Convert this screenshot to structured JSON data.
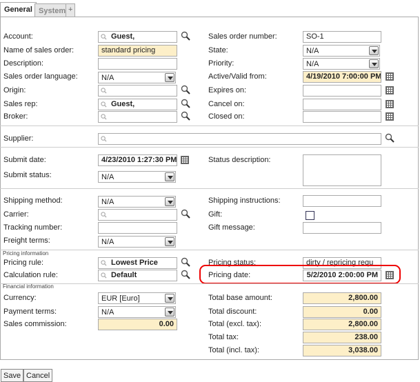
{
  "tabs": [
    "General",
    "System",
    "+"
  ],
  "left": {
    "account": {
      "label": "Account:",
      "value": "Guest,"
    },
    "order_name": {
      "label": "Name of sales order:",
      "value": "standard pricing"
    },
    "description": {
      "label": "Description:",
      "value": ""
    },
    "language": {
      "label": "Sales order language:",
      "value": "N/A"
    },
    "origin": {
      "label": "Origin:",
      "value": ""
    },
    "sales_rep": {
      "label": "Sales rep:",
      "value": "Guest,"
    },
    "broker": {
      "label": "Broker:",
      "value": ""
    }
  },
  "right": {
    "order_number": {
      "label": "Sales order number:",
      "value": "SO-1"
    },
    "state": {
      "label": "State:",
      "value": "N/A"
    },
    "priority": {
      "label": "Priority:",
      "value": "N/A"
    },
    "active_from": {
      "label": "Active/Valid from:",
      "value": "4/19/2010 7:00:00 PM"
    },
    "expires_on": {
      "label": "Expires on:",
      "value": ""
    },
    "cancel_on": {
      "label": "Cancel on:",
      "value": ""
    },
    "closed_on": {
      "label": "Closed on:",
      "value": ""
    }
  },
  "supplier": {
    "label": "Supplier:",
    "value": ""
  },
  "submit": {
    "date": {
      "label": "Submit date:",
      "value": "4/23/2010 1:27:30 PM"
    },
    "status": {
      "label": "Submit status:",
      "value": "N/A"
    },
    "status_description": {
      "label": "Status description:",
      "value": ""
    }
  },
  "shipping": {
    "method": {
      "label": "Shipping method:",
      "value": "N/A"
    },
    "carrier": {
      "label": "Carrier:",
      "value": ""
    },
    "tracking": {
      "label": "Tracking number:",
      "value": ""
    },
    "freight": {
      "label": "Freight terms:",
      "value": "N/A"
    },
    "instructions": {
      "label": "Shipping instructions:",
      "value": ""
    },
    "gift": {
      "label": "Gift:"
    },
    "gift_message": {
      "label": "Gift message:",
      "value": ""
    }
  },
  "pricing": {
    "section": "Pricing information",
    "rule": {
      "label": "Pricing rule:",
      "value": "Lowest Price"
    },
    "calc_rule": {
      "label": "Calculation rule:",
      "value": "Default"
    },
    "status": {
      "label": "Pricing status:",
      "value": "dirty / repricing requ"
    },
    "date": {
      "label": "Pricing date:",
      "value": "5/2/2010 2:00:00 PM"
    }
  },
  "financial": {
    "section": "Financial information",
    "currency": {
      "label": "Currency:",
      "value": "EUR [Euro]"
    },
    "payment_terms": {
      "label": "Payment terms:",
      "value": "N/A"
    },
    "commission": {
      "label": "Sales commission:",
      "value": "0.00"
    },
    "total_base": {
      "label": "Total base amount:",
      "value": "2,800.00"
    },
    "total_discount": {
      "label": "Total discount:",
      "value": "0.00"
    },
    "total_excl": {
      "label": "Total (excl. tax):",
      "value": "2,800.00"
    },
    "total_tax": {
      "label": "Total tax:",
      "value": "238.00"
    },
    "total_incl": {
      "label": "Total (incl. tax):",
      "value": "3,038.00"
    }
  },
  "buttons": {
    "save": "Save",
    "cancel": "Cancel"
  },
  "colors": {
    "highlight": "#e00000",
    "field_yellow": "#fdefc8"
  }
}
